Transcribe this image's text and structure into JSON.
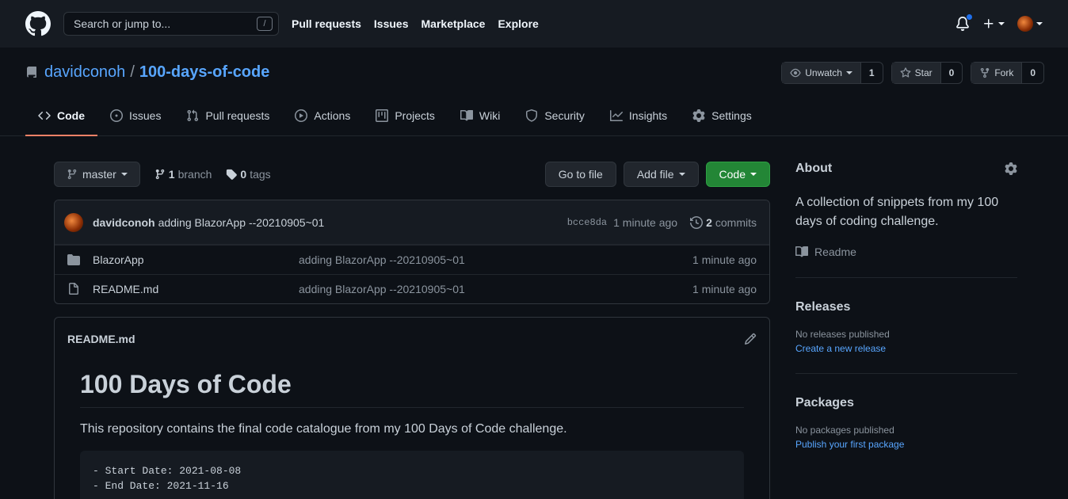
{
  "header": {
    "search_placeholder": "Search or jump to...",
    "search_shortcut": "/",
    "nav": [
      "Pull requests",
      "Issues",
      "Marketplace",
      "Explore"
    ]
  },
  "repo": {
    "owner": "davidconoh",
    "separator": "/",
    "name": "100-days-of-code",
    "watch_label": "Unwatch",
    "watch_count": "1",
    "star_label": "Star",
    "star_count": "0",
    "fork_label": "Fork",
    "fork_count": "0"
  },
  "tabs": [
    "Code",
    "Issues",
    "Pull requests",
    "Actions",
    "Projects",
    "Wiki",
    "Security",
    "Insights",
    "Settings"
  ],
  "filenav": {
    "branch": "master",
    "branch_count": "1",
    "branch_label": "branch",
    "tag_count": "0",
    "tag_label": "tags",
    "goto_file": "Go to file",
    "add_file": "Add file",
    "code": "Code"
  },
  "commit": {
    "author": "davidconoh",
    "message": "adding BlazorApp --20210905~01",
    "sha": "bcce8da",
    "age": "1 minute ago",
    "commit_count": "2",
    "commit_label": "commits"
  },
  "files": [
    {
      "type": "folder",
      "name": "BlazorApp",
      "message": "adding BlazorApp --20210905~01",
      "age": "1 minute ago"
    },
    {
      "type": "file",
      "name": "README.md",
      "message": "adding BlazorApp --20210905~01",
      "age": "1 minute ago"
    }
  ],
  "readme": {
    "filename": "README.md",
    "title": "100 Days of Code",
    "intro": "This repository contains the final code catalogue from my 100 Days of Code challenge.",
    "code_lines": [
      "- Start Date: 2021-08-08",
      "- End Date: 2021-11-16"
    ]
  },
  "sidebar": {
    "about_title": "About",
    "description": "A collection of snippets from my 100 days of coding challenge.",
    "readme_label": "Readme",
    "releases_title": "Releases",
    "releases_empty": "No releases published",
    "releases_link": "Create a new release",
    "packages_title": "Packages",
    "packages_empty": "No packages published",
    "packages_link": "Publish your first package"
  },
  "colors": {
    "background": "#0d1117",
    "header": "#161b22",
    "link": "#58a6ff",
    "accent_tab": "#f78166",
    "green_button": "#238636",
    "notification_dot": "#1f6feb"
  }
}
